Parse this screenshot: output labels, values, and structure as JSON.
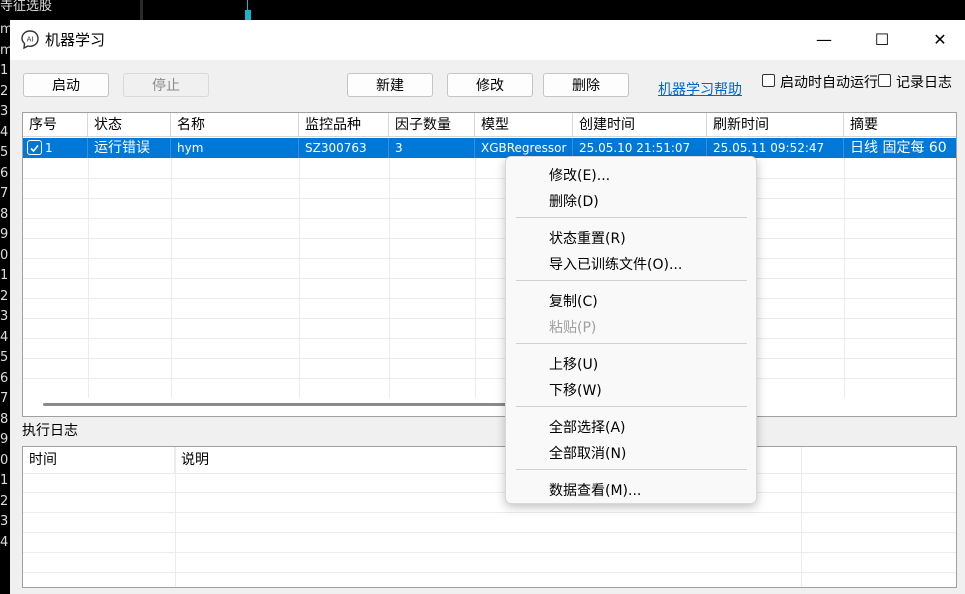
{
  "background": {
    "top_text": "寺征选股",
    "left_numbers": [
      "m",
      "m",
      "1",
      "2",
      "3",
      "4",
      "5",
      "6",
      "7",
      "8",
      "9",
      "0",
      "1",
      "2",
      "3",
      "4",
      "5",
      "6",
      "7",
      "8",
      "9",
      "0",
      "1",
      "2",
      "3",
      "4"
    ]
  },
  "window": {
    "title": "机器学习",
    "icon_label": "AI",
    "minimize": "—",
    "maximize": "☐",
    "close": "✕"
  },
  "toolbar": {
    "start": "启动",
    "stop": "停止",
    "new": "新建",
    "edit": "修改",
    "delete": "删除",
    "help_link": "机器学习帮助",
    "auto_run_label": "启动时自动运行",
    "log_label": "记录日志"
  },
  "table": {
    "columns": [
      "序号",
      "状态",
      "名称",
      "监控品种",
      "因子数量",
      "模型",
      "创建时间",
      "刷新时间",
      "摘要"
    ],
    "rows": [
      {
        "index": "1",
        "status": "运行错误",
        "name": "hym",
        "symbol": "SZ300763",
        "factors": "3",
        "model": "XGBRegressor",
        "created": "25.05.10 21:51:07",
        "refreshed": "25.05.11 09:52:47",
        "summary": "日线  固定每 60"
      }
    ]
  },
  "log": {
    "label": "执行日志",
    "columns": [
      "时间",
      "说明"
    ]
  },
  "context_menu": {
    "items": [
      {
        "label": "修改(E)..."
      },
      {
        "label": "删除(D)"
      },
      {
        "label": "状态重置(R)"
      },
      {
        "label": "导入已训练文件(O)..."
      },
      {
        "label": "复制(C)"
      },
      {
        "label": "粘贴(P)"
      },
      {
        "label": "上移(U)"
      },
      {
        "label": "下移(W)"
      },
      {
        "label": "全部选择(A)"
      },
      {
        "label": "全部取消(N)"
      },
      {
        "label": "数据查看(M)..."
      }
    ]
  },
  "colors": {
    "selection": "#0078d7",
    "link": "#0066cc"
  }
}
